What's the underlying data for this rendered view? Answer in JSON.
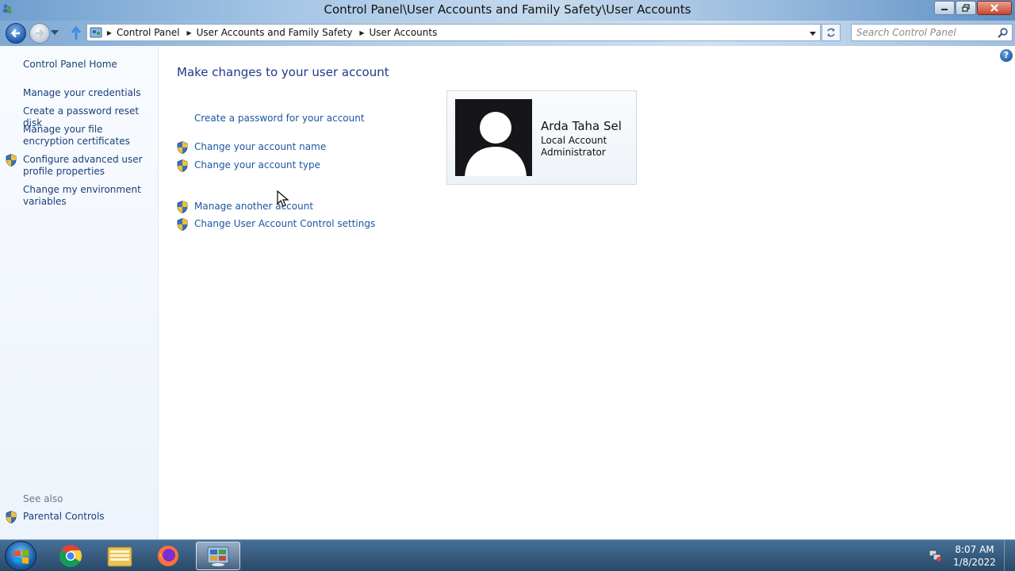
{
  "window": {
    "title": "Control Panel\\User Accounts and Family Safety\\User Accounts",
    "controls": [
      "minimize-icon",
      "restore-icon",
      "close-icon"
    ]
  },
  "navbar": {
    "breadcrumbs": [
      "Control Panel",
      "User Accounts and Family Safety",
      "User Accounts"
    ],
    "search_placeholder": "Search Control Panel"
  },
  "sidebar": {
    "home": "Control Panel Home",
    "links": [
      {
        "label": "Manage your credentials",
        "shield": false
      },
      {
        "label": "Create a password reset disk",
        "shield": false
      },
      {
        "label": "Manage your file encryption certificates",
        "shield": false
      },
      {
        "label": "Configure advanced user profile properties",
        "shield": true
      },
      {
        "label": "Change my environment variables",
        "shield": false
      }
    ],
    "see_also": "See also",
    "see_also_links": [
      {
        "label": "Parental Controls",
        "shield": true
      }
    ]
  },
  "main": {
    "title": "Make changes to your user account",
    "tasks": [
      {
        "label": "Create a password for your account",
        "shield": false
      },
      {
        "label": "Change your account name",
        "shield": true
      },
      {
        "label": "Change your account type",
        "shield": true
      }
    ],
    "other_tasks": [
      {
        "label": "Manage another account",
        "shield": true
      },
      {
        "label": "Change User Account Control settings",
        "shield": true
      }
    ],
    "account": {
      "name": "Arda Taha Sel",
      "type": "Local Account",
      "role": "Administrator"
    }
  },
  "taskbar": {
    "apps": [
      "chrome-icon",
      "file-explorer-icon",
      "firefox-icon",
      "control-panel-icon"
    ],
    "active_app": "control-panel-icon",
    "time": "8:07 AM",
    "date": "1/8/2022"
  },
  "colors": {
    "link": "#1d56a0",
    "title": "#1e3a8a",
    "sidebar_link": "#1a3f7a"
  }
}
